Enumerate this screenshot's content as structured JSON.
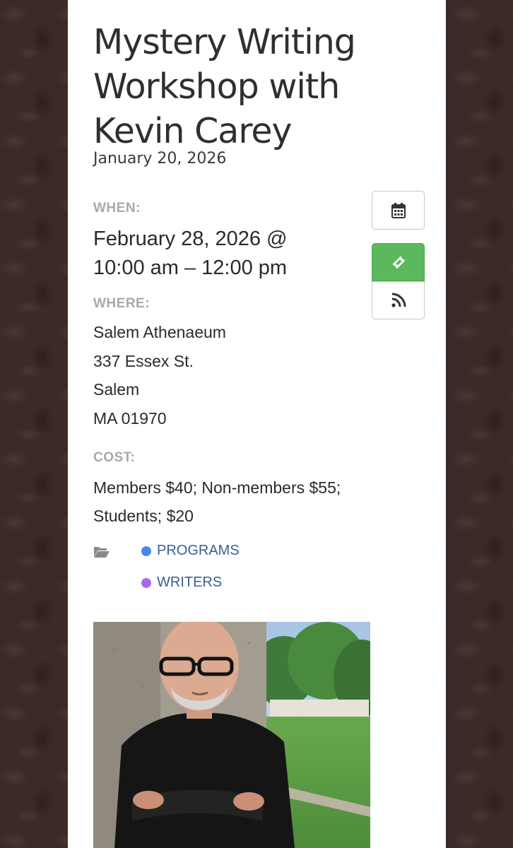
{
  "event": {
    "title": "Mystery Writing Workshop with Kevin Carey",
    "posted_date": "January 20, 2026",
    "when_label": "WHEN:",
    "when_value": "February 28, 2026 @ 10:00 am – 12:00 pm",
    "where_label": "WHERE:",
    "where_lines": [
      "Salem Athenaeum",
      "337 Essex St.",
      "Salem",
      "MA 01970"
    ],
    "cost_label": "COST:",
    "cost_value": "Members $40; Non-members $55; Students; $20"
  },
  "categories": [
    {
      "label": "PROGRAMS",
      "color": "#4a86e8"
    },
    {
      "label": "WRITERS",
      "color": "#a66bea"
    }
  ],
  "actions": {
    "calendar_icon": "calendar-icon",
    "ticket_icon": "ticket-icon",
    "rss_icon": "rss-icon"
  },
  "colors": {
    "ticket_button": "#5cb85c",
    "category_link": "#3c5f94",
    "label_gray": "#a9a9a9"
  },
  "image": {
    "icon": "portrait-photo"
  }
}
